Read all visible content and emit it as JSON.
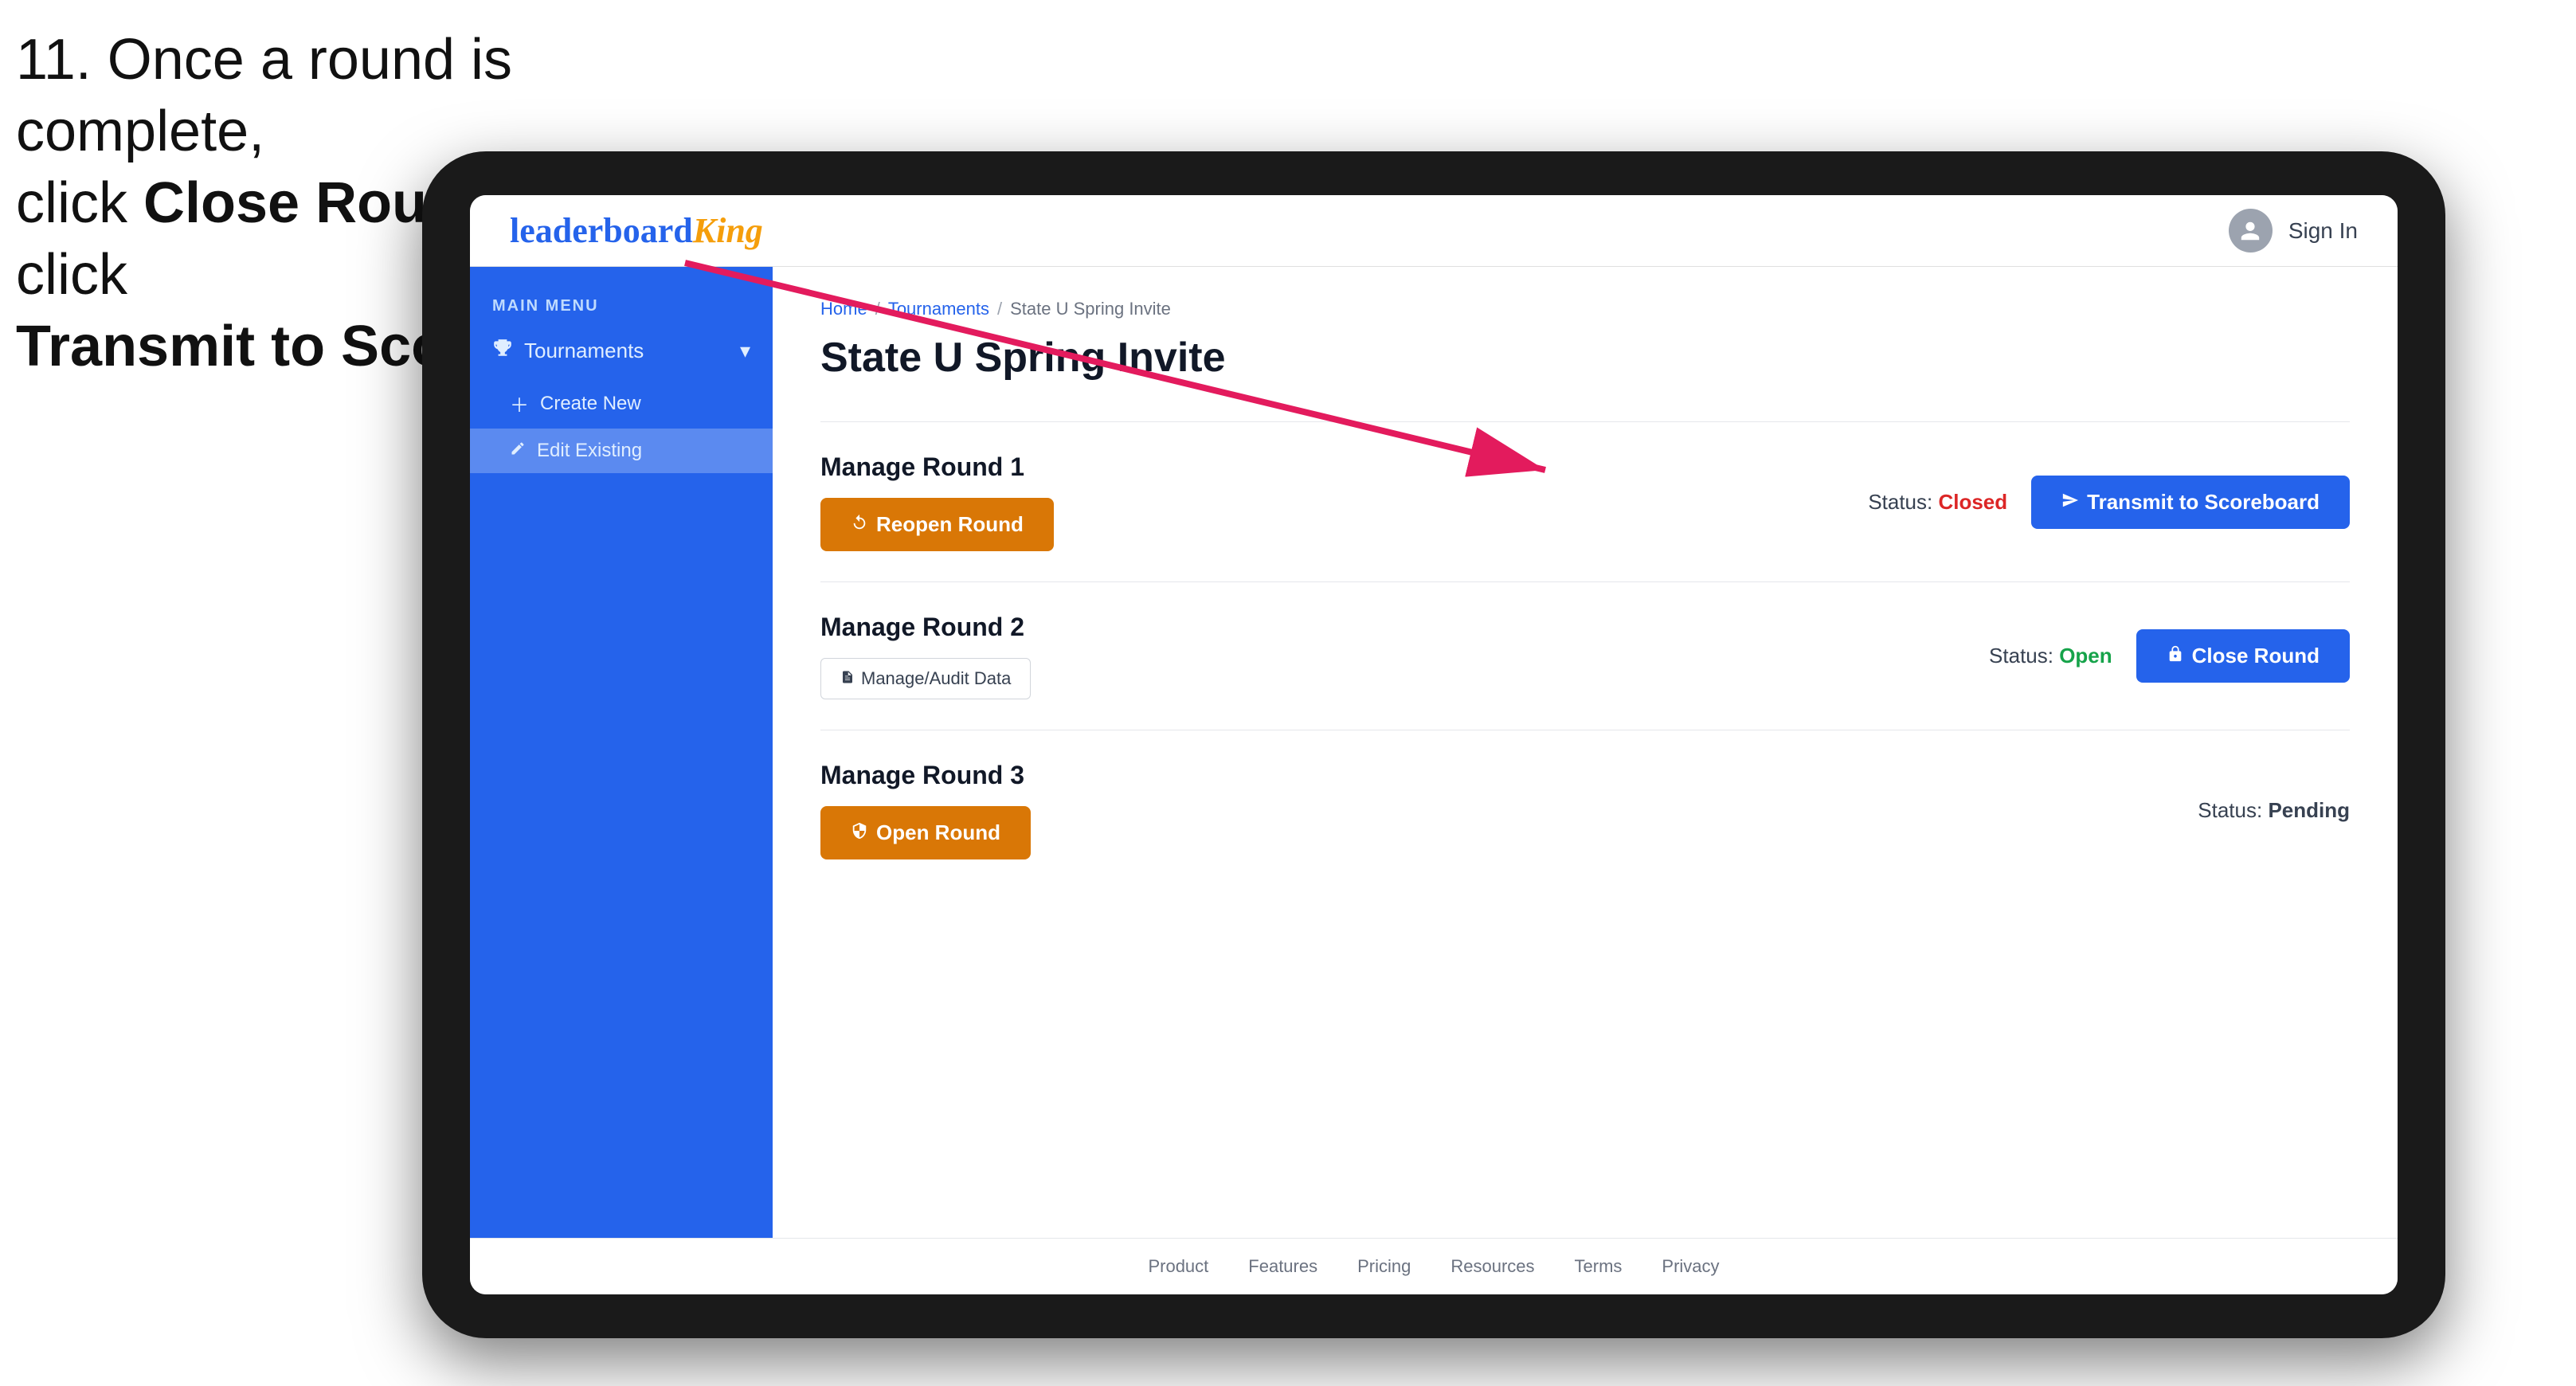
{
  "instruction": {
    "line1": "11. Once a round is complete,",
    "line2": "click ",
    "bold1": "Close Round",
    "line3": " then click",
    "bold2": "Transmit to Scoreboard."
  },
  "header": {
    "logo_regular": "leaderboard",
    "logo_king": "King",
    "sign_in_label": "Sign In"
  },
  "sidebar": {
    "main_menu_label": "MAIN MENU",
    "tournaments_label": "Tournaments",
    "create_new_label": "Create New",
    "edit_existing_label": "Edit Existing"
  },
  "breadcrumb": {
    "home": "Home",
    "sep1": "/",
    "tournaments": "Tournaments",
    "sep2": "/",
    "current": "State U Spring Invite"
  },
  "page": {
    "title": "State U Spring Invite"
  },
  "rounds": [
    {
      "id": "round1",
      "title": "Manage Round 1",
      "status_label": "Status:",
      "status_value": "Closed",
      "status_type": "closed",
      "primary_button": "Reopen Round",
      "primary_button_type": "amber",
      "secondary_button": "Transmit to Scoreboard",
      "secondary_button_type": "blue"
    },
    {
      "id": "round2",
      "title": "Manage Round 2",
      "status_label": "Status:",
      "status_value": "Open",
      "status_type": "open",
      "audit_button": "Manage/Audit Data",
      "secondary_button": "Close Round",
      "secondary_button_type": "blue"
    },
    {
      "id": "round3",
      "title": "Manage Round 3",
      "status_label": "Status:",
      "status_value": "Pending",
      "status_type": "pending",
      "primary_button": "Open Round",
      "primary_button_type": "amber"
    }
  ],
  "footer": {
    "links": [
      "Product",
      "Features",
      "Pricing",
      "Resources",
      "Terms",
      "Privacy"
    ]
  }
}
